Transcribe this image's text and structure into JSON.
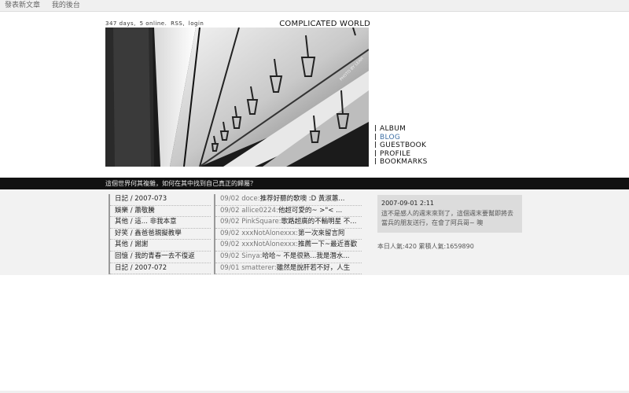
{
  "topbar": {
    "new_post": "發表新文章",
    "my_backend": "我的後台"
  },
  "stats": {
    "days": "347 days,",
    "online": "5 online.",
    "rss": "RSS,",
    "login": "login"
  },
  "site_title": "COMPLICATED WORLD",
  "banner": {
    "credit": "PHOTO BY LEAH"
  },
  "nav": [
    {
      "label": "ALBUM",
      "active": false
    },
    {
      "label": "BLOG",
      "active": true
    },
    {
      "label": "GUESTBOOK",
      "active": false
    },
    {
      "label": "PROFILE",
      "active": false
    },
    {
      "label": "BOOKMARKS",
      "active": false
    }
  ],
  "tagline": "這個世界何其複雜，如何在其中找到自己真正的歸屬？",
  "categories": [
    "日記 / 2007-073",
    "娛樂 / 蕭敬騰",
    "其他 / 這... 非我本意",
    "好笑 / 鑫爸爸親擬教學",
    "其他 / 謝謝",
    "回憶 / 我的青春一去不復返",
    "日記 / 2007-072"
  ],
  "comments": [
    {
      "date": "09/02",
      "author": "doce:",
      "text": "推荐好聽的歌噢 :D 黃淑蕙..."
    },
    {
      "date": "09/02",
      "author": "allice0224:",
      "text": "他超可愛的~ >\"< ..."
    },
    {
      "date": "09/02",
      "author": "PinkSquare:",
      "text": "歌路超廣的不輸明星 不..."
    },
    {
      "date": "09/02",
      "author": "xxxNotAlonexxx:",
      "text": "第一次來留言阿"
    },
    {
      "date": "09/02",
      "author": "xxxNotAlonexxx:",
      "text": "推薦一下~最近喜歡"
    },
    {
      "date": "09/02",
      "author": "Sinya:",
      "text": "哈哈~ 不是很熟...我是潛水..."
    },
    {
      "date": "09/01",
      "author": "smatterer:",
      "text": "雖然是說肝若不好，人生"
    }
  ],
  "notice": {
    "timestamp": "2007-09-01 2:11",
    "message": "這不是感人的週末來到了，這個週末要幫即將去當兵的朋友送行，在會了阿兵哥~ 噢"
  },
  "counter": "本日人氣:420 累積人氣:1659890",
  "colors": {
    "accent": "#3e6fa5",
    "tagline_bg": "#111111",
    "content_bg": "#f2f2f2"
  }
}
